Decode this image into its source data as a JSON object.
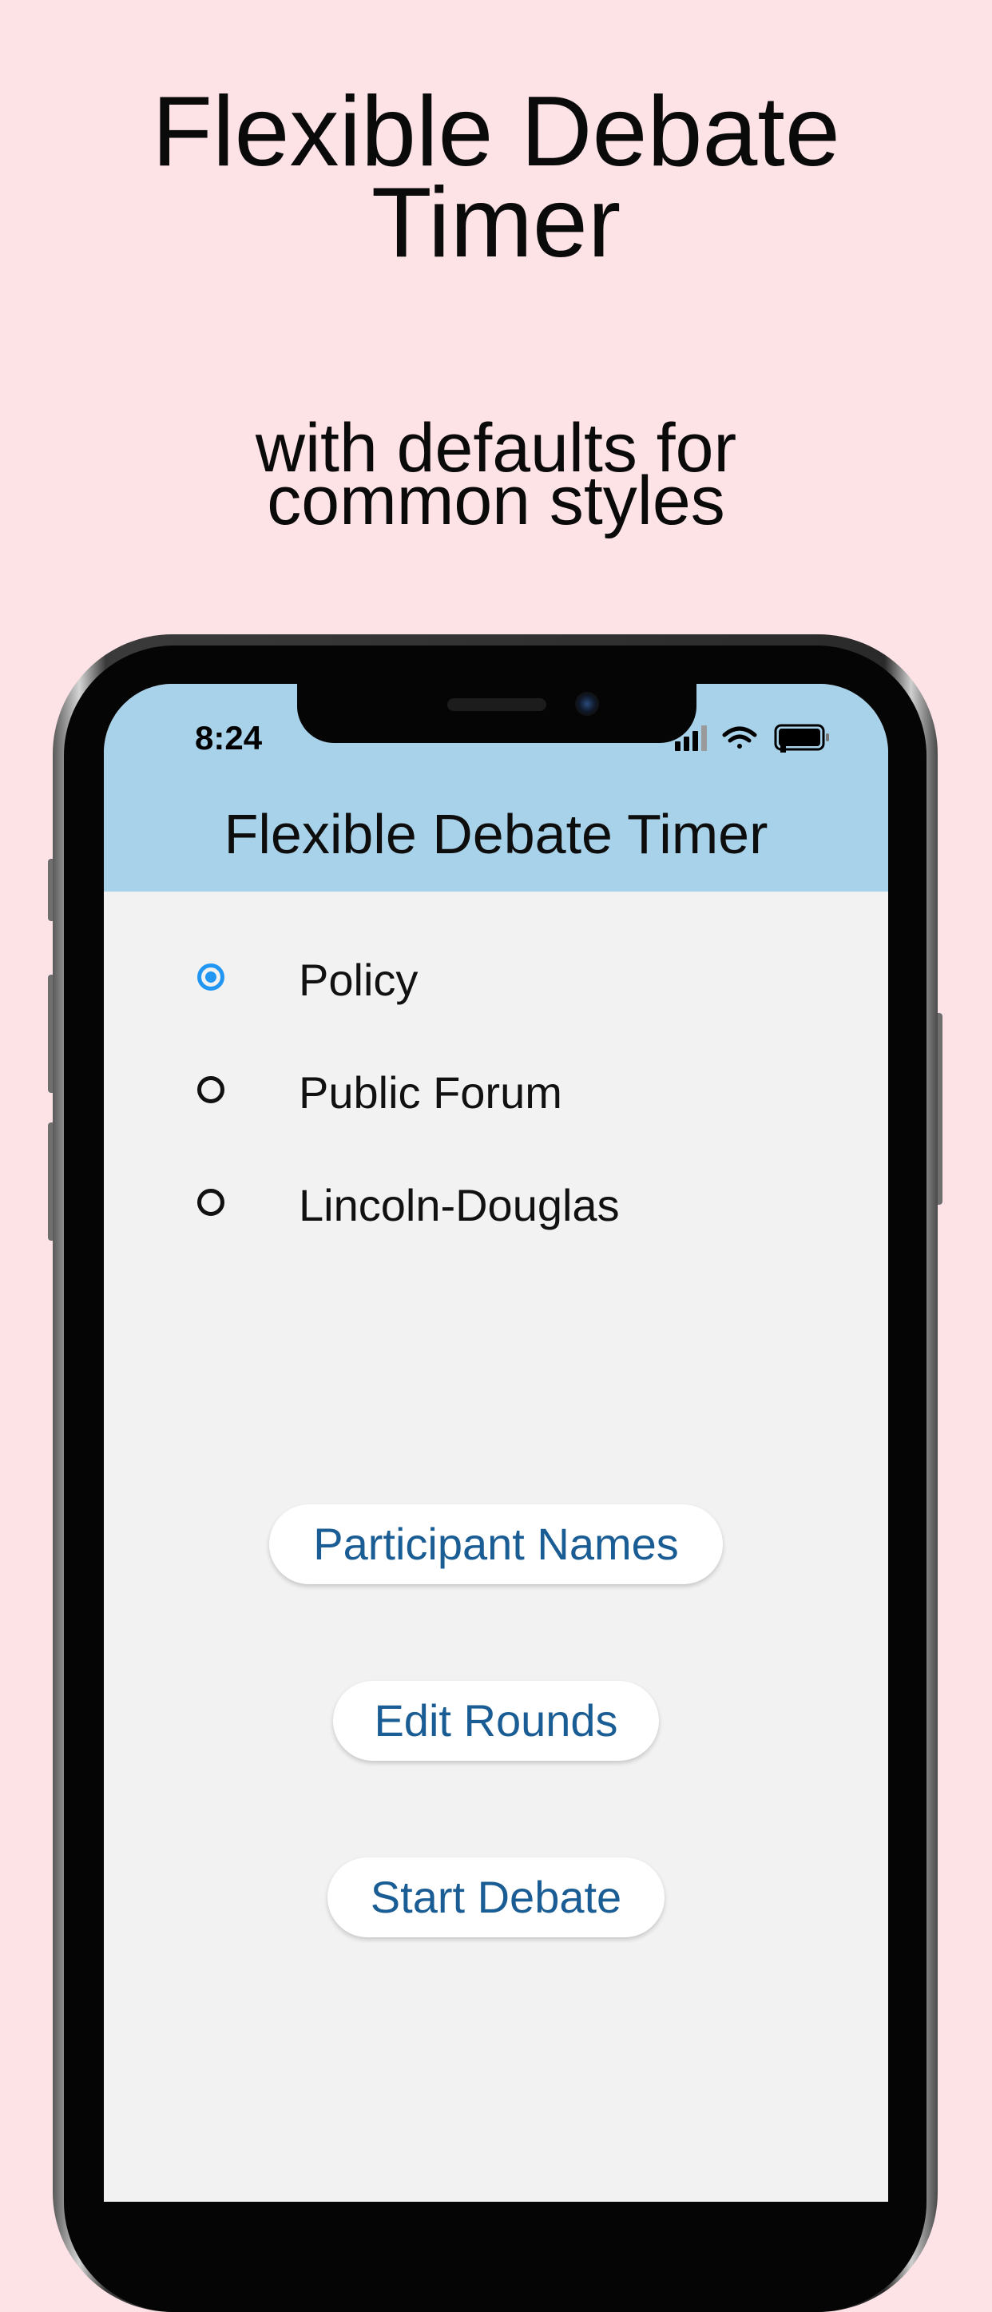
{
  "promo": {
    "title_line1": "Flexible Debate",
    "title_line2": "Timer",
    "subtitle_line1": "with defaults for",
    "subtitle_line2": "common styles"
  },
  "status_bar": {
    "time": "8:24",
    "icons": [
      "cellular-signal-icon",
      "wifi-icon",
      "battery-icon"
    ]
  },
  "app": {
    "header_title": "Flexible Debate Timer",
    "header_color": "#a8d2e9",
    "background_color": "#f2f2f2",
    "accent_color": "#2196f3",
    "button_text_color": "#1a5d94",
    "debate_styles": [
      {
        "label": "Policy",
        "selected": true
      },
      {
        "label": "Public Forum",
        "selected": false
      },
      {
        "label": "Lincoln-Douglas",
        "selected": false
      }
    ],
    "buttons": {
      "participant_names": "Participant Names",
      "edit_rounds": "Edit Rounds",
      "start_debate": "Start Debate"
    }
  }
}
